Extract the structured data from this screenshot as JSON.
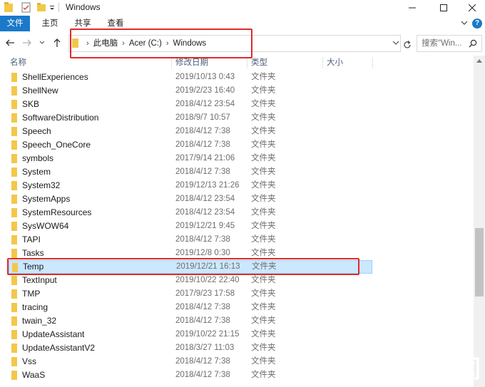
{
  "window": {
    "title": "Windows"
  },
  "ribbon": {
    "tabs": [
      "文件",
      "主页",
      "共享",
      "查看"
    ],
    "help": "?"
  },
  "address": {
    "crumbs": [
      "此电脑",
      "Acer (C:)",
      "Windows"
    ]
  },
  "search": {
    "placeholder": "搜索\"Win..."
  },
  "columns": {
    "name": "名称",
    "date": "修改日期",
    "type": "类型",
    "size": "大小"
  },
  "files": [
    {
      "name": "ShellExperiences",
      "date": "2019/10/13 0:43",
      "type": "文件夹"
    },
    {
      "name": "ShellNew",
      "date": "2019/2/23 16:40",
      "type": "文件夹"
    },
    {
      "name": "SKB",
      "date": "2018/4/12 23:54",
      "type": "文件夹"
    },
    {
      "name": "SoftwareDistribution",
      "date": "2018/9/7 10:57",
      "type": "文件夹"
    },
    {
      "name": "Speech",
      "date": "2018/4/12 7:38",
      "type": "文件夹"
    },
    {
      "name": "Speech_OneCore",
      "date": "2018/4/12 7:38",
      "type": "文件夹"
    },
    {
      "name": "symbols",
      "date": "2017/9/14 21:06",
      "type": "文件夹"
    },
    {
      "name": "System",
      "date": "2018/4/12 7:38",
      "type": "文件夹"
    },
    {
      "name": "System32",
      "date": "2019/12/13 21:26",
      "type": "文件夹"
    },
    {
      "name": "SystemApps",
      "date": "2018/4/12 23:54",
      "type": "文件夹"
    },
    {
      "name": "SystemResources",
      "date": "2018/4/12 23:54",
      "type": "文件夹"
    },
    {
      "name": "SysWOW64",
      "date": "2019/12/21 9:45",
      "type": "文件夹"
    },
    {
      "name": "TAPI",
      "date": "2018/4/12 7:38",
      "type": "文件夹"
    },
    {
      "name": "Tasks",
      "date": "2019/12/8 0:30",
      "type": "文件夹"
    },
    {
      "name": "Temp",
      "date": "2019/12/21 16:13",
      "type": "文件夹",
      "selected": true
    },
    {
      "name": "TextInput",
      "date": "2019/10/22 22:40",
      "type": "文件夹"
    },
    {
      "name": "TMP",
      "date": "2017/9/23 17:58",
      "type": "文件夹"
    },
    {
      "name": "tracing",
      "date": "2018/4/12 7:38",
      "type": "文件夹"
    },
    {
      "name": "twain_32",
      "date": "2018/4/12 7:38",
      "type": "文件夹"
    },
    {
      "name": "UpdateAssistant",
      "date": "2019/10/22 21:15",
      "type": "文件夹"
    },
    {
      "name": "UpdateAssistantV2",
      "date": "2018/3/27 11:03",
      "type": "文件夹"
    },
    {
      "name": "Vss",
      "date": "2018/4/12 7:38",
      "type": "文件夹"
    },
    {
      "name": "WaaS",
      "date": "2018/4/12 7:38",
      "type": "文件夹"
    }
  ],
  "colors": {
    "accent": "#1979ca",
    "selection_fill": "#cce8ff",
    "selection_border": "#99d1ff",
    "folder": "#f2c84b",
    "highlight_box": "#e02a2a",
    "watermark": "#ffffff"
  },
  "watermark": {
    "text": "广东龙网"
  }
}
